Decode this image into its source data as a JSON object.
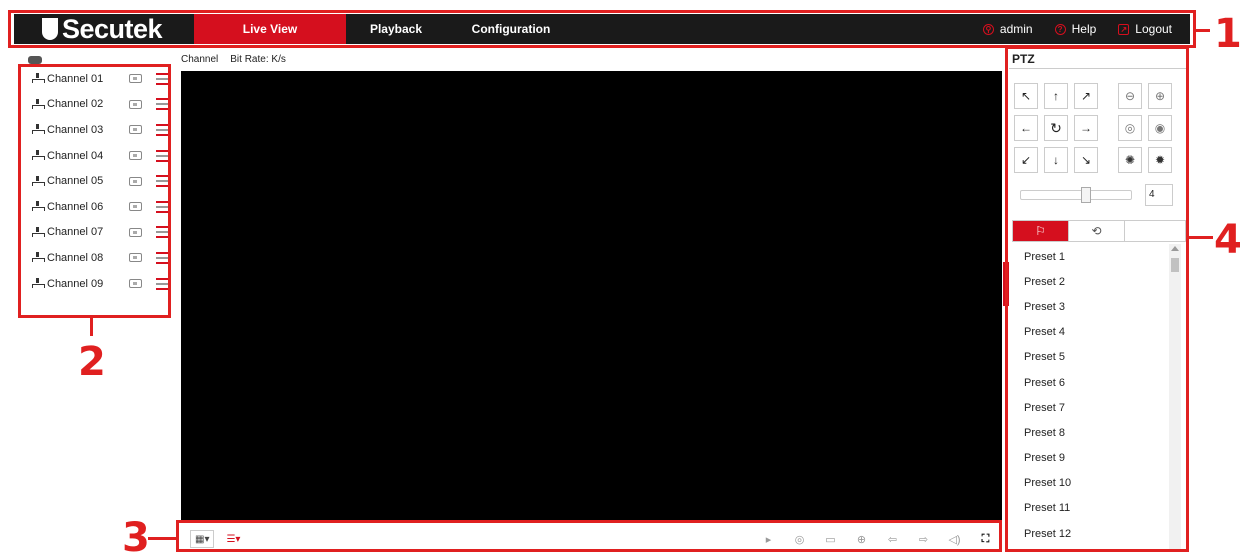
{
  "brand": {
    "logo_text": "Secutek"
  },
  "nav": [
    {
      "label": "Live View",
      "active": true
    },
    {
      "label": "Playback",
      "active": false
    },
    {
      "label": "Configuration",
      "active": false
    }
  ],
  "user": {
    "name": "admin",
    "help": "Help",
    "logout": "Logout"
  },
  "channels": [
    "Channel 01",
    "Channel 02",
    "Channel 03",
    "Channel 04",
    "Channel 05",
    "Channel 06",
    "Channel 07",
    "Channel 08",
    "Channel 09"
  ],
  "video": {
    "channel_label": "Channel",
    "bitrate_label": "Bit Rate: K/s"
  },
  "ptz": {
    "title": "PTZ",
    "speed": "4",
    "presets": [
      "Preset 1",
      "Preset 2",
      "Preset 3",
      "Preset 4",
      "Preset 5",
      "Preset 6",
      "Preset 7",
      "Preset 8",
      "Preset 9",
      "Preset 10",
      "Preset 11",
      "Preset 12"
    ]
  },
  "annotations": [
    "1",
    "2",
    "3",
    "4"
  ],
  "colors": {
    "accent": "#d50f1e",
    "annotation": "#e02020",
    "topbar": "#1a1a1a"
  }
}
